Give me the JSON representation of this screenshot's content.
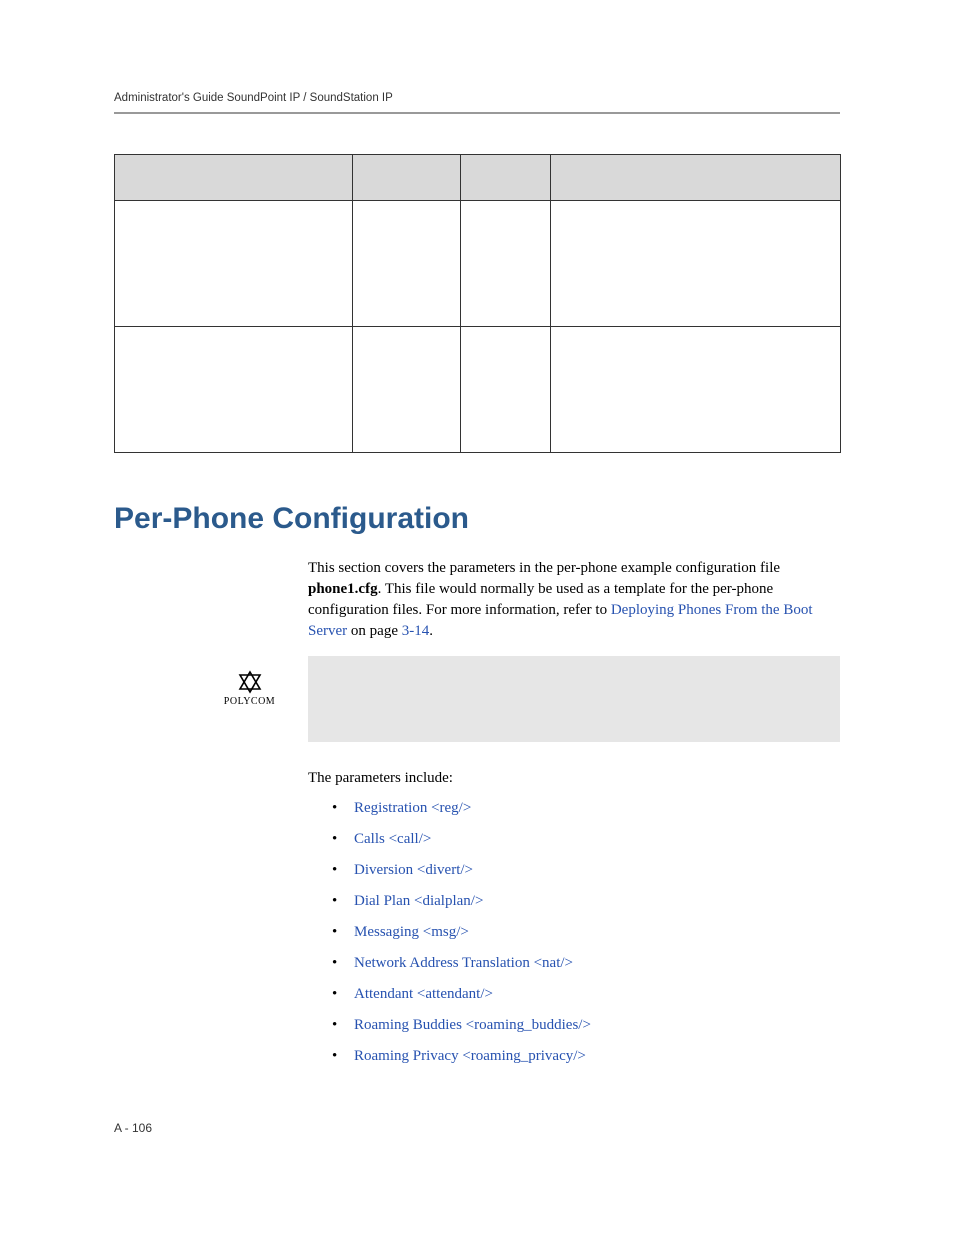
{
  "header": {
    "title": "Administrator's Guide SoundPoint IP / SoundStation IP"
  },
  "table": {
    "headers": {
      "attribute": "",
      "permitted": "",
      "default": "",
      "interpretation": ""
    },
    "rows": [
      {
        "attribute": "",
        "permitted": "",
        "default": "",
        "interpretation": ""
      },
      {
        "attribute": "",
        "permitted": "",
        "default": "",
        "interpretation": ""
      }
    ]
  },
  "section": {
    "title": "Per-Phone Configuration",
    "intro_prefix": "This section covers the parameters in the per-phone example configuration file ",
    "intro_bold": "phone1.cfg",
    "intro_mid": ". This file would normally be used as a template for the per-phone configuration files. For more information, refer to ",
    "intro_link1": "Deploying Phones From the Boot Server",
    "intro_onpage": " on page ",
    "intro_link2": "3-14",
    "intro_end": "."
  },
  "logo": {
    "text": "POLYCOM"
  },
  "params_intro": "The parameters include:",
  "params": [
    "Registration <reg/>",
    "Calls <call/>",
    "Diversion <divert/>",
    "Dial Plan <dialplan/>",
    "Messaging <msg/>",
    "Network Address Translation <nat/>",
    "Attendant <attendant/>",
    "Roaming Buddies <roaming_buddies/>",
    "Roaming Privacy <roaming_privacy/>"
  ],
  "footer": {
    "page": "A - 106"
  }
}
